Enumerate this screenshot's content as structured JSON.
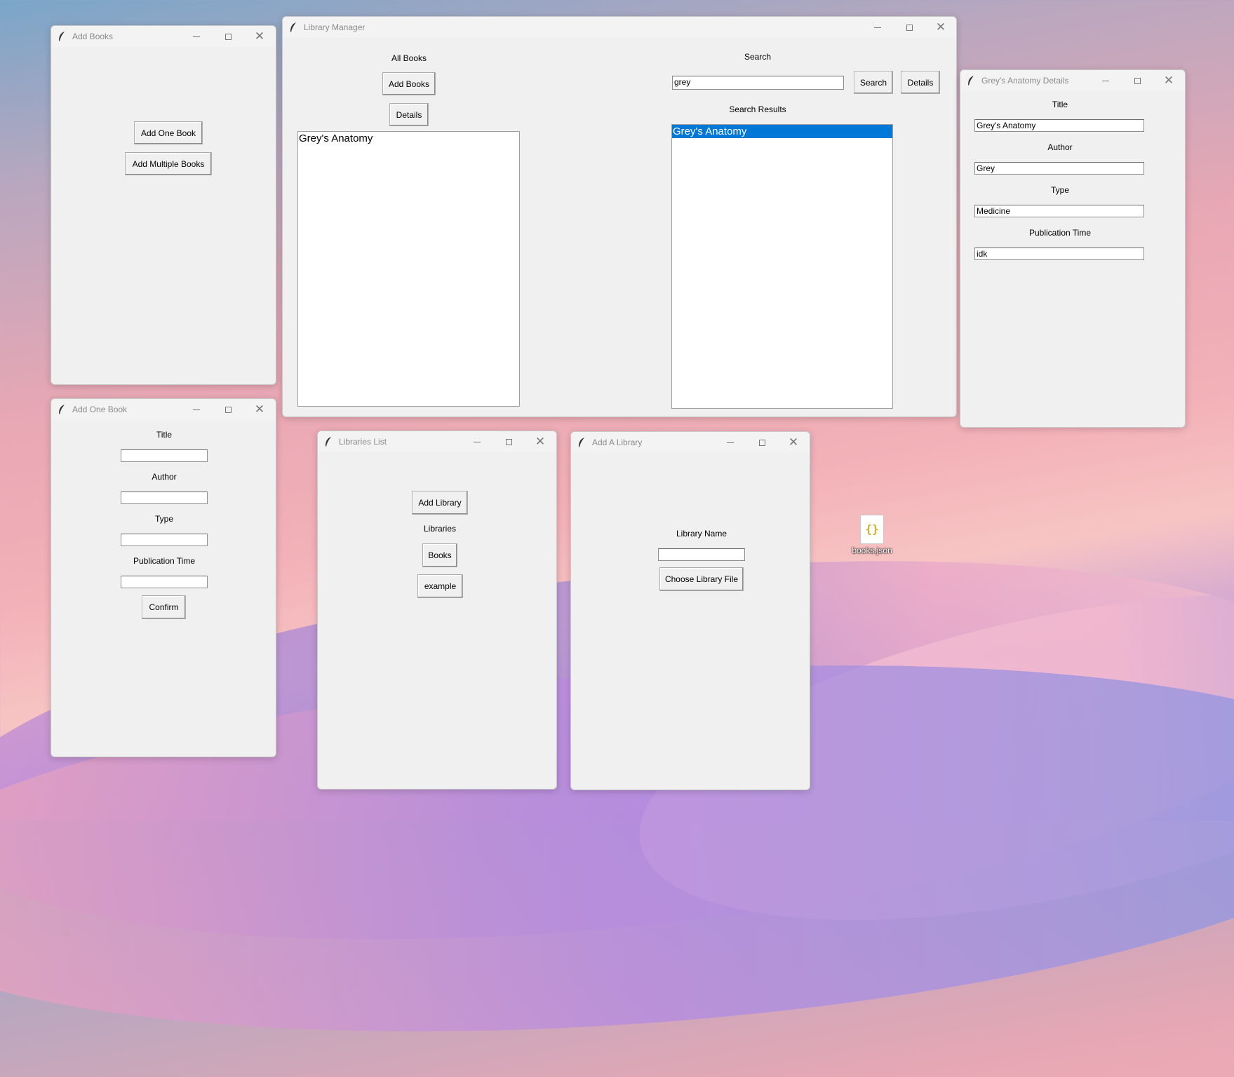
{
  "desktop": {
    "file_icon_label": "books.json",
    "file_icon_glyph": "{}"
  },
  "windows": {
    "add_books": {
      "title": "Add Books",
      "add_one_book": "Add One Book",
      "add_multiple_books": "Add Multiple Books"
    },
    "library_manager": {
      "title": "Library Manager",
      "all_books_label": "All Books",
      "add_books_button": "Add Books",
      "details_button": "Details",
      "all_books_list": [
        "Grey's Anatomy"
      ],
      "search_label": "Search",
      "search_value": "grey",
      "search_button": "Search",
      "search_details_button": "Details",
      "search_results_label": "Search Results",
      "search_results": [
        "Grey's Anatomy"
      ],
      "selected_result": "Grey's Anatomy"
    },
    "details": {
      "title": "Grey's Anatomy Details",
      "title_label": "Title",
      "title_value": "Grey's Anatomy",
      "author_label": "Author",
      "author_value": "Grey",
      "type_label": "Type",
      "type_value": "Medicine",
      "pub_label": "Publication Time",
      "pub_value": "idk"
    },
    "add_one_book": {
      "title": "Add One Book",
      "title_label": "Title",
      "author_label": "Author",
      "type_label": "Type",
      "pub_label": "Publication Time",
      "confirm": "Confirm"
    },
    "libraries_list": {
      "title": "Libraries List",
      "add_library": "Add Library",
      "libraries_label": "Libraries",
      "items": [
        "Books",
        "example"
      ]
    },
    "add_library": {
      "title": "Add A Library",
      "name_label": "Library Name",
      "choose_file": "Choose Library File"
    }
  },
  "window_controls": {
    "minimize": "—",
    "maximize": "☐",
    "close": "✕"
  },
  "colors": {
    "selection": "#0078d7",
    "window_bg": "#f0f0f0"
  }
}
